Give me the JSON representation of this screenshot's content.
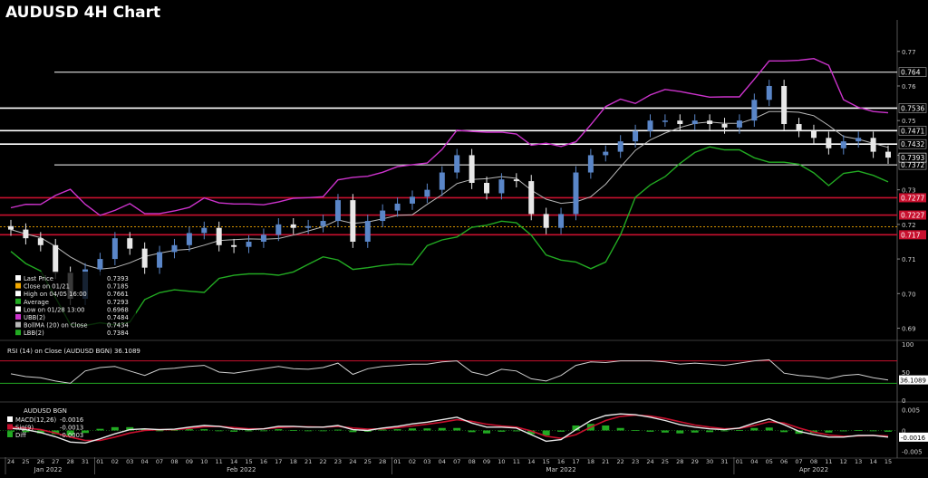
{
  "title": "AUDUSD 4H Chart",
  "colors": {
    "background": "#000000",
    "candle_up": "#5a86c8",
    "candle_down": "#e8e8e8",
    "ubb": "#cc33cc",
    "lbb": "#22aa22",
    "ma": "#b8b8b8",
    "support_line": "#ffffff",
    "resistance_line": "#c8102e",
    "rsi_line": "#cfcfcf",
    "rsi_upper": "#c8102e",
    "rsi_lower": "#22aa22",
    "macd_line": "#e8e8e8",
    "signal_line": "#c8102e",
    "diff_hist": "#22aa22"
  },
  "legend": {
    "items": [
      {
        "label": "Last Price",
        "value": "0.7393",
        "color": "#ffffff"
      },
      {
        "label": "Close on 01/21",
        "value": "0.7185",
        "color": "#f2a900"
      },
      {
        "label": "High on 04/05 16:00",
        "value": "0.7661",
        "color": "#ffffff"
      },
      {
        "label": "Average",
        "value": "0.7293",
        "color": "#22aa22"
      },
      {
        "label": "Low on 01/28 13:00",
        "value": "0.6968",
        "color": "#ffffff"
      },
      {
        "label": "UBB(2)",
        "value": "0.7484",
        "color": "#cc33cc"
      },
      {
        "label": "BollMA (20) on Close",
        "value": "0.7434",
        "color": "#b8b8b8"
      },
      {
        "label": "LBB(2)",
        "value": "0.7384",
        "color": "#22aa22"
      }
    ]
  },
  "rsi_label": "RSI (14) on Close (AUDUSD BGN) 36.1089",
  "macd_header": "AUDUSD BGN",
  "macd_legend": [
    {
      "label": "MACD(12,26)",
      "value": "-0.0016",
      "color": "#ffffff"
    },
    {
      "label": "Sig(9)",
      "value": "-0.0013",
      "color": "#c8102e"
    },
    {
      "label": "Diff",
      "value": "-0.0003",
      "color": "#22aa22"
    }
  ],
  "chart_data": [
    {
      "type": "candlestick",
      "title": "AUDUSD 4H Chart",
      "ylim": [
        0.687,
        0.777
      ],
      "yticks": [
        "0.77",
        "0.76",
        "0.75",
        "0.74",
        "0.73",
        "0.72",
        "0.71",
        "0.70",
        "0.69"
      ],
      "horizontal_levels": [
        {
          "value": 0.764,
          "label": "0.764",
          "color": "#ffffff"
        },
        {
          "value": 0.7536,
          "label": "0.7536",
          "color": "#ffffff"
        },
        {
          "value": 0.7471,
          "label": "0.7471",
          "color": "#ffffff"
        },
        {
          "value": 0.7432,
          "label": "0.7432",
          "color": "#ffffff"
        },
        {
          "value": 0.7372,
          "label": "0.7372",
          "color": "#ffffff"
        },
        {
          "value": 0.7277,
          "label": "0.7277",
          "color": "#c8102e"
        },
        {
          "value": 0.7227,
          "label": "0.7227",
          "color": "#c8102e"
        },
        {
          "value": 0.717,
          "label": "0.717",
          "color": "#c8102e"
        }
      ],
      "last_price": {
        "value": 0.7393,
        "label": "0.7393"
      },
      "close_series": [
        {
          "date": "01/24",
          "close": 0.7185
        },
        {
          "date": "01/25",
          "close": 0.716
        },
        {
          "date": "01/26",
          "close": 0.714
        },
        {
          "date": "01/27",
          "close": 0.706
        },
        {
          "date": "01/28",
          "close": 0.6985
        },
        {
          "date": "01/31",
          "close": 0.707
        },
        {
          "date": "02/01",
          "close": 0.71
        },
        {
          "date": "02/02",
          "close": 0.716
        },
        {
          "date": "02/03",
          "close": 0.713
        },
        {
          "date": "02/04",
          "close": 0.7075
        },
        {
          "date": "02/07",
          "close": 0.712
        },
        {
          "date": "02/08",
          "close": 0.714
        },
        {
          "date": "02/09",
          "close": 0.7175
        },
        {
          "date": "02/10",
          "close": 0.719
        },
        {
          "date": "02/11",
          "close": 0.714
        },
        {
          "date": "02/14",
          "close": 0.7135
        },
        {
          "date": "02/15",
          "close": 0.715
        },
        {
          "date": "02/16",
          "close": 0.717
        },
        {
          "date": "02/17",
          "close": 0.72
        },
        {
          "date": "02/18",
          "close": 0.719
        },
        {
          "date": "02/21",
          "close": 0.7195
        },
        {
          "date": "02/22",
          "close": 0.721
        },
        {
          "date": "02/23",
          "close": 0.727
        },
        {
          "date": "02/24",
          "close": 0.715
        },
        {
          "date": "02/25",
          "close": 0.721
        },
        {
          "date": "02/28",
          "close": 0.724
        },
        {
          "date": "03/01",
          "close": 0.726
        },
        {
          "date": "03/02",
          "close": 0.728
        },
        {
          "date": "03/03",
          "close": 0.73
        },
        {
          "date": "03/04",
          "close": 0.735
        },
        {
          "date": "03/07",
          "close": 0.74
        },
        {
          "date": "03/08",
          "close": 0.732
        },
        {
          "date": "03/09",
          "close": 0.729
        },
        {
          "date": "03/10",
          "close": 0.733
        },
        {
          "date": "03/11",
          "close": 0.7325
        },
        {
          "date": "03/14",
          "close": 0.723
        },
        {
          "date": "03/15",
          "close": 0.719
        },
        {
          "date": "03/16",
          "close": 0.723
        },
        {
          "date": "03/17",
          "close": 0.735
        },
        {
          "date": "03/18",
          "close": 0.74
        },
        {
          "date": "03/21",
          "close": 0.741
        },
        {
          "date": "03/22",
          "close": 0.744
        },
        {
          "date": "03/23",
          "close": 0.747
        },
        {
          "date": "03/24",
          "close": 0.75
        },
        {
          "date": "03/25",
          "close": 0.75
        },
        {
          "date": "03/28",
          "close": 0.749
        },
        {
          "date": "03/29",
          "close": 0.75
        },
        {
          "date": "03/30",
          "close": 0.749
        },
        {
          "date": "03/31",
          "close": 0.748
        },
        {
          "date": "04/01",
          "close": 0.75
        },
        {
          "date": "04/04",
          "close": 0.756
        },
        {
          "date": "04/05",
          "close": 0.76
        },
        {
          "date": "04/06",
          "close": 0.749
        },
        {
          "date": "04/07",
          "close": 0.747
        },
        {
          "date": "04/08",
          "close": 0.745
        },
        {
          "date": "04/11",
          "close": 0.742
        },
        {
          "date": "04/12",
          "close": 0.744
        },
        {
          "date": "04/13",
          "close": 0.745
        },
        {
          "date": "04/14",
          "close": 0.741
        },
        {
          "date": "04/15",
          "close": 0.7393
        }
      ]
    },
    {
      "type": "line",
      "title": "RSI (14) on Close (AUDUSD BGN) 36.1089",
      "ylim": [
        0,
        100
      ],
      "yticks": [
        "100",
        "50",
        "0"
      ],
      "levels": [
        70,
        30
      ],
      "last_value": {
        "value": 36.1089,
        "label": "36.1089"
      },
      "values": [
        47,
        42,
        40,
        34,
        30,
        52,
        58,
        60,
        52,
        44,
        55,
        57,
        60,
        62,
        50,
        48,
        52,
        56,
        60,
        56,
        55,
        58,
        66,
        46,
        56,
        60,
        62,
        64,
        64,
        68,
        70,
        50,
        44,
        55,
        52,
        38,
        34,
        44,
        62,
        68,
        67,
        70,
        70,
        70,
        68,
        64,
        66,
        64,
        62,
        66,
        70,
        72,
        48,
        44,
        42,
        38,
        44,
        46,
        40,
        36
      ]
    },
    {
      "type": "line",
      "title": "AUDUSD BGN",
      "ylim": [
        -0.006,
        0.006
      ],
      "yticks": [
        "0.005",
        "0",
        "-0.005"
      ],
      "last_value": {
        "value": -0.0016,
        "label": "-0.0016"
      },
      "series": [
        {
          "name": "MACD(12,26)",
          "values": [
            0.0005,
            0.0002,
            -0.0005,
            -0.0015,
            -0.0028,
            -0.003,
            -0.002,
            -0.0008,
            0.0002,
            0.0004,
            0.0002,
            0.0003,
            0.0008,
            0.0012,
            0.001,
            0.0004,
            0.0002,
            0.0004,
            0.001,
            0.001,
            0.0008,
            0.0008,
            0.0012,
            0.0002,
            0.0,
            0.0006,
            0.001,
            0.0016,
            0.002,
            0.0026,
            0.0032,
            0.0018,
            0.0008,
            0.0008,
            0.0006,
            -0.001,
            -0.0026,
            -0.0022,
            0.0002,
            0.0024,
            0.0036,
            0.004,
            0.0038,
            0.0032,
            0.0024,
            0.0014,
            0.0008,
            0.0004,
            0.0002,
            0.0006,
            0.0018,
            0.0028,
            0.0014,
            -0.0002,
            -0.001,
            -0.0016,
            -0.0016,
            -0.0012,
            -0.0012,
            -0.0016
          ]
        },
        {
          "name": "Sig(9)",
          "values": [
            0.0008,
            0.0006,
            0.0002,
            -0.0006,
            -0.0016,
            -0.0024,
            -0.0024,
            -0.0016,
            -0.0006,
            0.0,
            0.0002,
            0.0002,
            0.0005,
            0.0009,
            0.001,
            0.0007,
            0.0004,
            0.0004,
            0.0007,
            0.0009,
            0.0009,
            0.0008,
            0.001,
            0.0006,
            0.0003,
            0.0004,
            0.0007,
            0.0011,
            0.0015,
            0.002,
            0.0026,
            0.0022,
            0.0015,
            0.0011,
            0.0008,
            -0.0001,
            -0.0014,
            -0.0019,
            -0.001,
            0.0008,
            0.0024,
            0.0034,
            0.0037,
            0.0035,
            0.0029,
            0.0021,
            0.0013,
            0.0008,
            0.0004,
            0.0005,
            0.0012,
            0.0021,
            0.0018,
            0.0006,
            -0.0004,
            -0.0011,
            -0.0014,
            -0.0013,
            -0.0012,
            -0.0013
          ]
        },
        {
          "name": "Diff",
          "values": [
            -0.0003,
            -0.0004,
            -0.0007,
            -0.0009,
            -0.0012,
            -0.0006,
            0.0004,
            0.0008,
            0.0008,
            0.0004,
            0.0,
            0.0001,
            0.0003,
            0.0003,
            0.0,
            -0.0003,
            -0.0002,
            0.0,
            0.0003,
            0.0001,
            -0.0001,
            0.0,
            0.0002,
            -0.0004,
            -0.0003,
            0.0002,
            0.0003,
            0.0005,
            0.0005,
            0.0006,
            0.0006,
            -0.0004,
            -0.0007,
            -0.0003,
            -0.0002,
            -0.0009,
            -0.0012,
            -0.0003,
            0.0012,
            0.0016,
            0.0012,
            0.0006,
            0.0001,
            -0.0003,
            -0.0005,
            -0.0007,
            -0.0005,
            -0.0004,
            -0.0002,
            0.0001,
            0.0006,
            0.0007,
            -0.0004,
            -0.0008,
            -0.0006,
            -0.0005,
            -0.0002,
            0.0001,
            0.0,
            -0.0003
          ]
        }
      ]
    }
  ],
  "x_axis": {
    "ticks": [
      "24",
      "25",
      "26",
      "27",
      "28",
      "31",
      "01",
      "02",
      "03",
      "04",
      "07",
      "08",
      "09",
      "10",
      "11",
      "14",
      "15",
      "16",
      "17",
      "18",
      "21",
      "22",
      "23",
      "24",
      "25",
      "28",
      "01",
      "02",
      "03",
      "04",
      "07",
      "08",
      "09",
      "10",
      "11",
      "14",
      "15",
      "16",
      "17",
      "18",
      "21",
      "22",
      "23",
      "24",
      "25",
      "28",
      "29",
      "30",
      "31",
      "01",
      "04",
      "05",
      "06",
      "07",
      "08",
      "11",
      "12",
      "13",
      "14",
      "15"
    ],
    "months": [
      {
        "label": "Jan 2022",
        "start": 0,
        "end": 5
      },
      {
        "label": "Feb 2022",
        "start": 6,
        "end": 25
      },
      {
        "label": "Mar 2022",
        "start": 26,
        "end": 48
      },
      {
        "label": "Apr 2022",
        "start": 49,
        "end": 59
      }
    ]
  }
}
